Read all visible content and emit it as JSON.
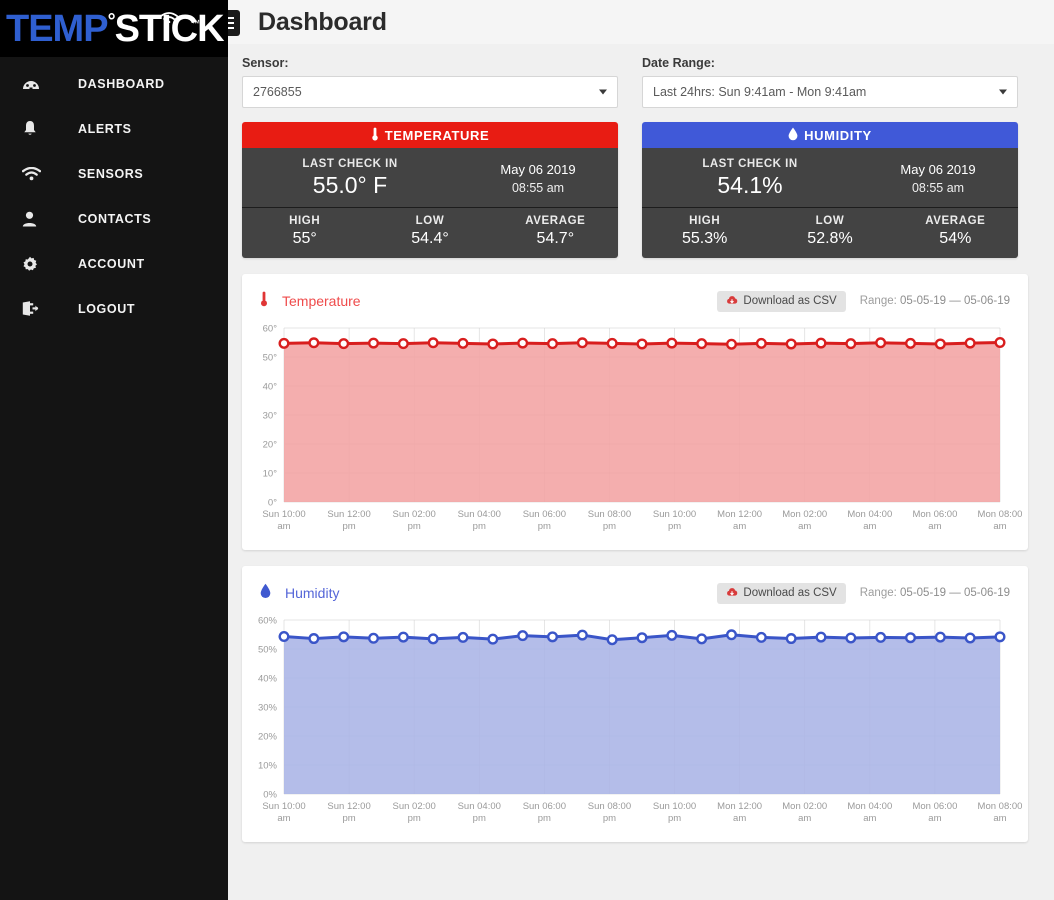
{
  "brand": {
    "part1": "TEMP",
    "degree": "°",
    "part2": "STICK",
    "tm": "™"
  },
  "sidebar": {
    "items": [
      {
        "label": "DASHBOARD",
        "icon": "dashboard-icon"
      },
      {
        "label": "ALERTS",
        "icon": "bell-icon"
      },
      {
        "label": "SENSORS",
        "icon": "wifi-icon"
      },
      {
        "label": "CONTACTS",
        "icon": "user-icon"
      },
      {
        "label": "ACCOUNT",
        "icon": "gear-icon"
      },
      {
        "label": "LOGOUT",
        "icon": "logout-icon"
      }
    ]
  },
  "header": {
    "title": "Dashboard",
    "menu_icon": "hamburger-icon"
  },
  "filters": {
    "sensor": {
      "label": "Sensor:",
      "value": "2766855"
    },
    "date_range": {
      "label": "Date Range:",
      "value": "Last 24hrs: Sun 9:41am - Mon 9:41am"
    }
  },
  "cards": [
    {
      "key": "temperature",
      "title": "TEMPERATURE",
      "icon": "thermometer-icon",
      "accent": "#e81c13",
      "last_check_label": "LAST CHECK IN",
      "last_check_value": "55.0° F",
      "date": "May 06 2019",
      "time": "08:55 am",
      "stats": [
        {
          "label": "HIGH",
          "value": "55°"
        },
        {
          "label": "LOW",
          "value": "54.4°"
        },
        {
          "label": "AVERAGE",
          "value": "54.7°"
        }
      ]
    },
    {
      "key": "humidity",
      "title": "HUMIDITY",
      "icon": "droplet-icon",
      "accent": "#4059d8",
      "last_check_label": "LAST CHECK IN",
      "last_check_value": "54.1%",
      "date": "May 06 2019",
      "time": "08:55 am",
      "stats": [
        {
          "label": "HIGH",
          "value": "55.3%"
        },
        {
          "label": "LOW",
          "value": "52.8%"
        },
        {
          "label": "AVERAGE",
          "value": "54%"
        }
      ]
    }
  ],
  "panels": [
    {
      "key": "temperature",
      "title": "Temperature",
      "icon": "thermometer-icon",
      "csv_label": "Download as CSV",
      "csv_icon": "cloud-download-icon",
      "range_label": "Range:",
      "range_value": "05-05-19 — 05-06-19"
    },
    {
      "key": "humidity",
      "title": "Humidity",
      "icon": "droplet-icon",
      "csv_label": "Download as CSV",
      "csv_icon": "cloud-download-icon",
      "range_label": "Range:",
      "range_value": "05-05-19 — 05-06-19"
    }
  ],
  "chart_data": [
    {
      "type": "area",
      "key": "temperature",
      "title": "Temperature",
      "xlabel": "",
      "ylabel": "",
      "ylim": [
        0,
        60
      ],
      "yticks": [
        0,
        10,
        20,
        30,
        40,
        50,
        60
      ],
      "ytick_labels": [
        "0°",
        "10°",
        "20°",
        "30°",
        "40°",
        "50°",
        "60°"
      ],
      "grid": true,
      "legend": false,
      "line_color": "#d81e1e",
      "fill_color": "#f3a3a3",
      "marker": "circle-open",
      "xtick_labels": [
        "Sun 10:00 am",
        "Sun 12:00 pm",
        "Sun 02:00 pm",
        "Sun 04:00 pm",
        "Sun 06:00 pm",
        "Sun 08:00 pm",
        "Sun 10:00 pm",
        "Mon 12:00 am",
        "Mon 02:00 am",
        "Mon 04:00 am",
        "Mon 06:00 am",
        "Mon 08:00 am"
      ],
      "values": [
        54.7,
        54.9,
        54.6,
        54.8,
        54.6,
        54.9,
        54.7,
        54.5,
        54.8,
        54.6,
        54.9,
        54.7,
        54.5,
        54.8,
        54.6,
        54.4,
        54.7,
        54.5,
        54.8,
        54.6,
        54.9,
        54.7,
        54.5,
        54.8,
        55.0
      ]
    },
    {
      "type": "area",
      "key": "humidity",
      "title": "Humidity",
      "xlabel": "",
      "ylabel": "",
      "ylim": [
        0,
        60
      ],
      "yticks": [
        0,
        10,
        20,
        30,
        40,
        50,
        60
      ],
      "ytick_labels": [
        "0%",
        "10%",
        "20%",
        "30%",
        "40%",
        "50%",
        "60%"
      ],
      "grid": true,
      "legend": false,
      "line_color": "#3a55c8",
      "fill_color": "#aab4e6",
      "marker": "circle-open",
      "xtick_labels": [
        "Sun 10:00 am",
        "Sun 12:00 pm",
        "Sun 02:00 pm",
        "Sun 04:00 pm",
        "Sun 06:00 pm",
        "Sun 08:00 pm",
        "Sun 10:00 pm",
        "Mon 12:00 am",
        "Mon 02:00 am",
        "Mon 04:00 am",
        "Mon 06:00 am",
        "Mon 08:00 am"
      ],
      "values": [
        54.3,
        53.6,
        54.2,
        53.7,
        54.1,
        53.5,
        54.0,
        53.4,
        54.6,
        54.2,
        54.8,
        53.2,
        53.9,
        54.7,
        53.5,
        54.9,
        54.0,
        53.6,
        54.1,
        53.8,
        54.0,
        53.9,
        54.1,
        53.8,
        54.2
      ]
    }
  ]
}
